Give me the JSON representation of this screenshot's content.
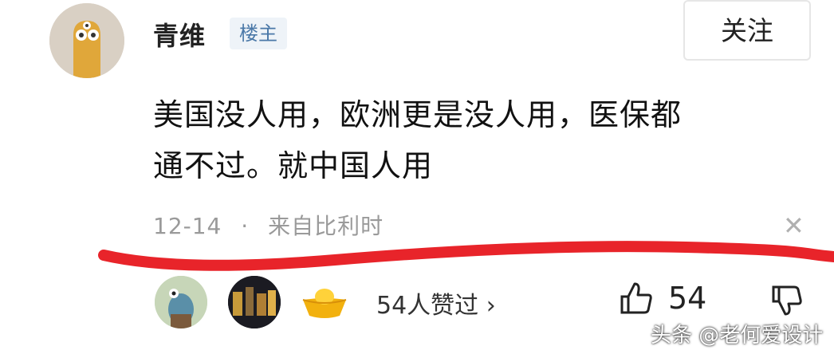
{
  "post": {
    "username": "青维",
    "op_badge": "楼主",
    "follow_label": "关注",
    "comment_line1": "美国没人用，欧洲更是没人用，医保都",
    "comment_line2": "通不过。就中国人用",
    "date": "12-14",
    "separator": "·",
    "location": "来自比利时",
    "close_icon": "close-icon"
  },
  "likes": {
    "summary": "54人赞过 ›",
    "count": "54",
    "thumb_up_icon": "thumb-up-icon",
    "thumb_down_icon": "thumb-down-icon"
  },
  "watermark": "头条 @老何爱设计",
  "colors": {
    "annotation_red": "#e8242a",
    "badge_blue": "#4a78a8",
    "meta_gray": "#9a9a9a"
  }
}
